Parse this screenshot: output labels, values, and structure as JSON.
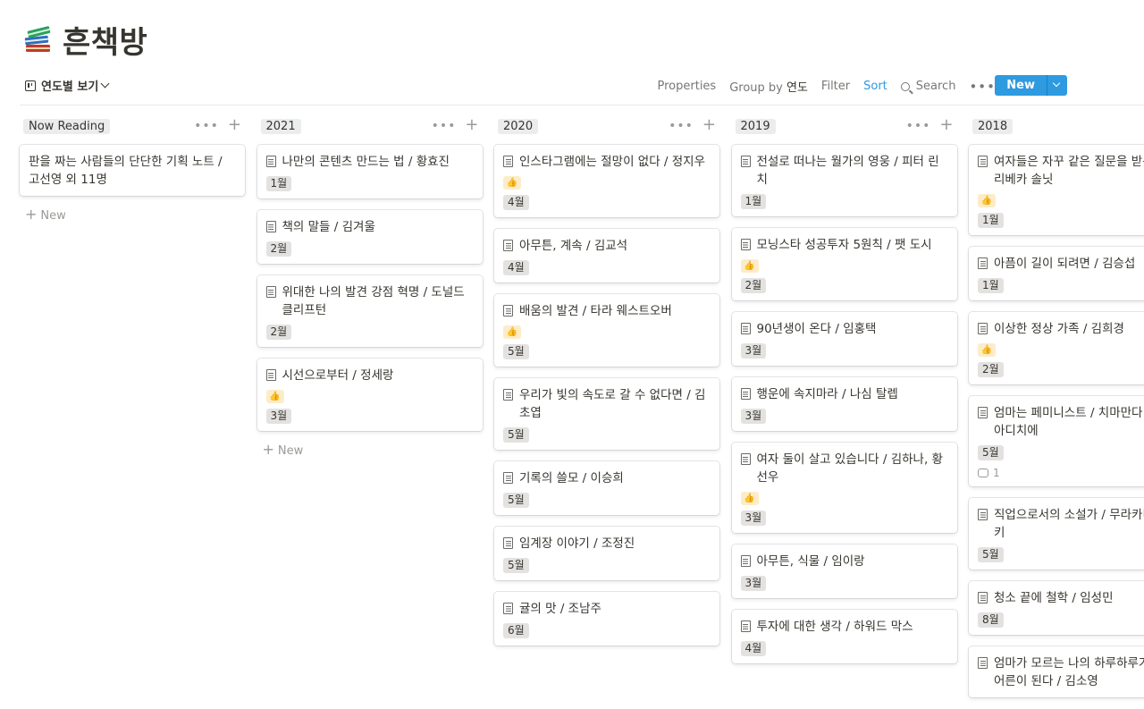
{
  "page": {
    "icon": "books-emoji-icon",
    "title": "흔책방"
  },
  "toolbar": {
    "view_label": "연도별 보기",
    "properties": "Properties",
    "group_by_label": "Group by",
    "group_by_value": "연도",
    "filter": "Filter",
    "sort": "Sort",
    "search": "Search",
    "more": "•••",
    "new": "New"
  },
  "board": {
    "add_new_label": "New",
    "columns": [
      {
        "label": "Now Reading",
        "cards": [
          {
            "title": "판을 짜는 사람들의 단단한 기획 노트 / 고선영 외 11명",
            "doc": false,
            "thumb": false,
            "month": ""
          }
        ]
      },
      {
        "label": "2021",
        "cards": [
          {
            "title": "나만의 콘텐츠 만드는 법 / 황효진",
            "doc": true,
            "thumb": false,
            "month": "1월"
          },
          {
            "title": "책의 말들 / 김겨울",
            "doc": true,
            "thumb": false,
            "month": "2월"
          },
          {
            "title": "위대한 나의 발견 강점 혁명 / 도널드 클리프턴",
            "doc": true,
            "thumb": false,
            "month": "2월"
          },
          {
            "title": "시선으로부터 / 정세랑",
            "doc": true,
            "thumb": true,
            "month": "3월"
          }
        ]
      },
      {
        "label": "2020",
        "cards": [
          {
            "title": "인스타그램에는 절망이 없다 / 정지우",
            "doc": true,
            "thumb": true,
            "month": "4월"
          },
          {
            "title": "아무튼, 계속 / 김교석",
            "doc": true,
            "thumb": false,
            "month": "4월"
          },
          {
            "title": "배움의 발견 / 타라 웨스트오버",
            "doc": true,
            "thumb": true,
            "month": "5월"
          },
          {
            "title": "우리가 빛의 속도로 갈 수 없다면 / 김초엽",
            "doc": true,
            "thumb": false,
            "month": "5월"
          },
          {
            "title": "기록의 쓸모 / 이승희",
            "doc": true,
            "thumb": false,
            "month": "5월"
          },
          {
            "title": "임계장 이야기 / 조정진",
            "doc": true,
            "thumb": false,
            "month": "5월"
          },
          {
            "title": "귤의 맛 / 조남주",
            "doc": true,
            "thumb": false,
            "month": "6월"
          }
        ]
      },
      {
        "label": "2019",
        "cards": [
          {
            "title": "전설로 떠나는 월가의 영웅 / 피터 린치",
            "doc": true,
            "thumb": false,
            "month": "1월"
          },
          {
            "title": "모닝스타 성공투자 5원칙 / 팻 도시",
            "doc": true,
            "thumb": true,
            "month": "2월"
          },
          {
            "title": "90년생이 온다 / 임홍택",
            "doc": true,
            "thumb": false,
            "month": "3월"
          },
          {
            "title": "행운에 속지마라 / 나심 탈렙",
            "doc": true,
            "thumb": false,
            "month": "3월"
          },
          {
            "title": "여자 둘이 살고 있습니다 / 김하나, 황선우",
            "doc": true,
            "thumb": true,
            "month": "3월"
          },
          {
            "title": "아무튼, 식물 / 임이랑",
            "doc": true,
            "thumb": false,
            "month": "3월"
          },
          {
            "title": "투자에 대한 생각 / 하워드 막스",
            "doc": true,
            "thumb": false,
            "month": "4월"
          }
        ]
      },
      {
        "label": "2018",
        "cards": [
          {
            "title": "여자들은 자꾸 같은 질문을 받는다 / 리베카 솔닛",
            "doc": true,
            "thumb": true,
            "month": "1월"
          },
          {
            "title": "아픔이 길이 되려면 / 김승섭",
            "doc": true,
            "thumb": false,
            "month": "1월"
          },
          {
            "title": "이상한 정상 가족 / 김희경",
            "doc": true,
            "thumb": true,
            "month": "2월"
          },
          {
            "title": "엄마는 페미니스트 / 치마만다 응고지 아디치에",
            "doc": true,
            "thumb": false,
            "month": "5월",
            "comments": "1"
          },
          {
            "title": "직업으로서의 소설가 / 무라카미 하루키",
            "doc": true,
            "thumb": false,
            "month": "5월"
          },
          {
            "title": "청소 끝에 철학 / 임성민",
            "doc": true,
            "thumb": false,
            "month": "8월"
          },
          {
            "title": "엄마가 모르는 나의 하루하루가 쌓여 어른이 된다 / 김소영",
            "doc": true,
            "thumb": false,
            "month": ""
          }
        ]
      }
    ]
  },
  "colors": {
    "accent": "#2e9ae0",
    "badge_bg": "#e3e2e0",
    "thumb_bg": "#fdecc8",
    "text": "#37352f"
  }
}
